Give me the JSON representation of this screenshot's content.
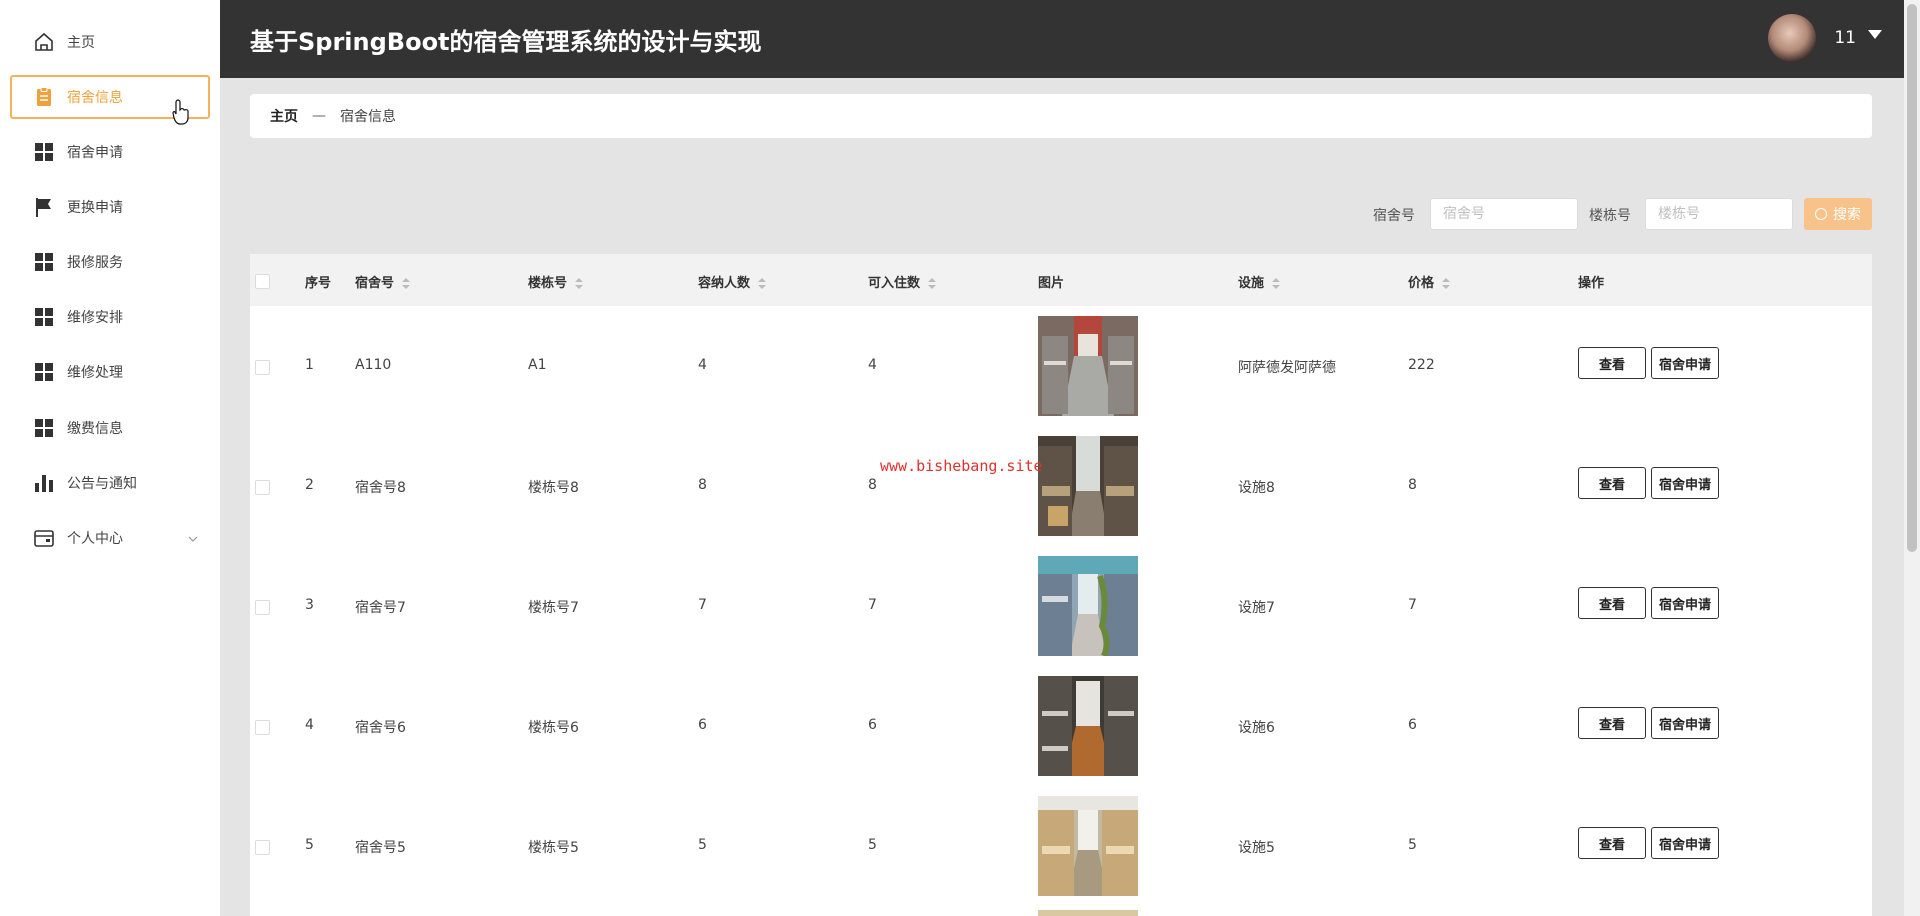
{
  "app": {
    "title": "基于SpringBoot的宿舍管理系统的设计与实现",
    "user_name": "11"
  },
  "sidebar": {
    "items": [
      {
        "label": "主页",
        "icon": "home-icon"
      },
      {
        "label": "宿舍信息",
        "icon": "clipboard-icon",
        "active": true
      },
      {
        "label": "宿舍申请",
        "icon": "grid-icon"
      },
      {
        "label": "更换申请",
        "icon": "flag-icon"
      },
      {
        "label": "报修服务",
        "icon": "grid-icon"
      },
      {
        "label": "维修安排",
        "icon": "grid-icon"
      },
      {
        "label": "维修处理",
        "icon": "grid-icon"
      },
      {
        "label": "缴费信息",
        "icon": "grid-icon"
      },
      {
        "label": "公告与通知",
        "icon": "bar-chart-icon"
      },
      {
        "label": "个人中心",
        "icon": "wallet-icon",
        "has_submenu": true
      }
    ]
  },
  "breadcrumb": {
    "home": "主页",
    "separator": "—",
    "current": "宿舍信息"
  },
  "search": {
    "dorm_label": "宿舍号",
    "dorm_placeholder": "宿舍号",
    "building_label": "楼栋号",
    "building_placeholder": "楼栋号",
    "button_label": "搜索"
  },
  "table": {
    "headers": {
      "index": "序号",
      "dorm_no": "宿舍号",
      "building_no": "楼栋号",
      "capacity": "容纳人数",
      "available": "可入住数",
      "image": "图片",
      "facilities": "设施",
      "price": "价格",
      "actions": "操作"
    },
    "rows": [
      {
        "index": "1",
        "dorm_no": "A110",
        "building_no": "A1",
        "capacity": "4",
        "available": "4",
        "facilities": "阿萨德发阿萨德",
        "price": "222",
        "view": "查看",
        "apply": "宿舍申请"
      },
      {
        "index": "2",
        "dorm_no": "宿舍号8",
        "building_no": "楼栋号8",
        "capacity": "8",
        "available": "8",
        "facilities": "设施8",
        "price": "8",
        "view": "查看",
        "apply": "宿舍申请"
      },
      {
        "index": "3",
        "dorm_no": "宿舍号7",
        "building_no": "楼栋号7",
        "capacity": "7",
        "available": "7",
        "facilities": "设施7",
        "price": "7",
        "view": "查看",
        "apply": "宿舍申请"
      },
      {
        "index": "4",
        "dorm_no": "宿舍号6",
        "building_no": "楼栋号6",
        "capacity": "6",
        "available": "6",
        "facilities": "设施6",
        "price": "6",
        "view": "查看",
        "apply": "宿舍申请"
      },
      {
        "index": "5",
        "dorm_no": "宿舍号5",
        "building_no": "楼栋号5",
        "capacity": "5",
        "available": "5",
        "facilities": "设施5",
        "price": "5",
        "view": "查看",
        "apply": "宿舍申请"
      }
    ]
  },
  "watermark": "www.bishebang.site",
  "colors": {
    "accent": "#f0a23a",
    "header_bg": "#333333",
    "search_button": "#f8c38a"
  }
}
